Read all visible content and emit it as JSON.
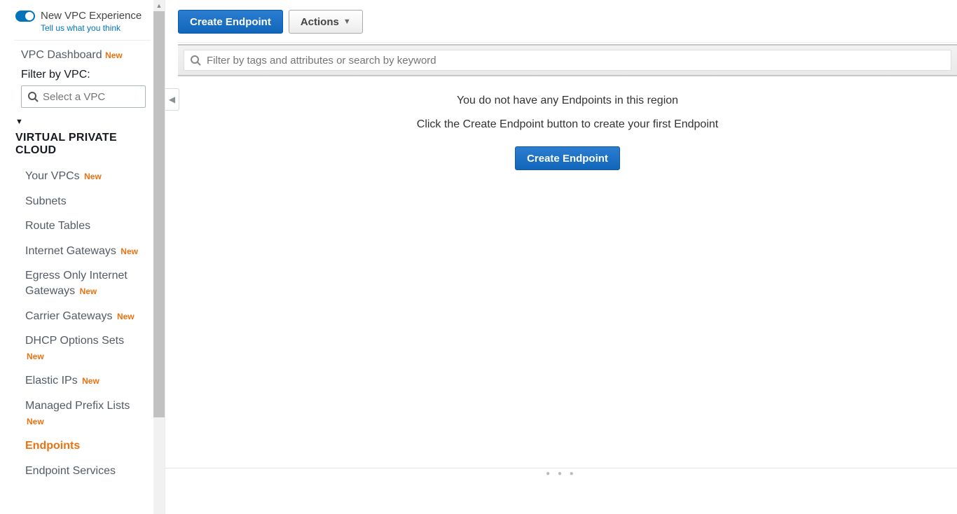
{
  "sidebar": {
    "toggle_label": "New VPC Experience",
    "tell_us": "Tell us what you think",
    "dashboard": "VPC Dashboard",
    "dashboard_new": "New",
    "filter_label": "Filter by VPC:",
    "vpc_placeholder": "Select a VPC",
    "section_title": "VIRTUAL PRIVATE CLOUD",
    "items": [
      {
        "label": "Your VPCs",
        "new": "New",
        "active": false
      },
      {
        "label": "Subnets",
        "new": "",
        "active": false
      },
      {
        "label": "Route Tables",
        "new": "",
        "active": false
      },
      {
        "label": "Internet Gateways",
        "new": "New",
        "active": false
      },
      {
        "label": "Egress Only Internet Gateways",
        "new": "New",
        "active": false
      },
      {
        "label": "Carrier Gateways",
        "new": "New",
        "active": false
      },
      {
        "label": "DHCP Options Sets",
        "new": "New",
        "active": false
      },
      {
        "label": "Elastic IPs",
        "new": "New",
        "active": false
      },
      {
        "label": "Managed Prefix Lists",
        "new": "New",
        "active": false
      },
      {
        "label": "Endpoints",
        "new": "",
        "active": true
      },
      {
        "label": "Endpoint Services",
        "new": "",
        "active": false
      }
    ]
  },
  "toolbar": {
    "create_label": "Create Endpoint",
    "actions_label": "Actions"
  },
  "filter": {
    "placeholder": "Filter by tags and attributes or search by keyword"
  },
  "empty": {
    "line1": "You do not have any Endpoints in this region",
    "line2": "Click the Create Endpoint button to create your first Endpoint",
    "button": "Create Endpoint"
  }
}
